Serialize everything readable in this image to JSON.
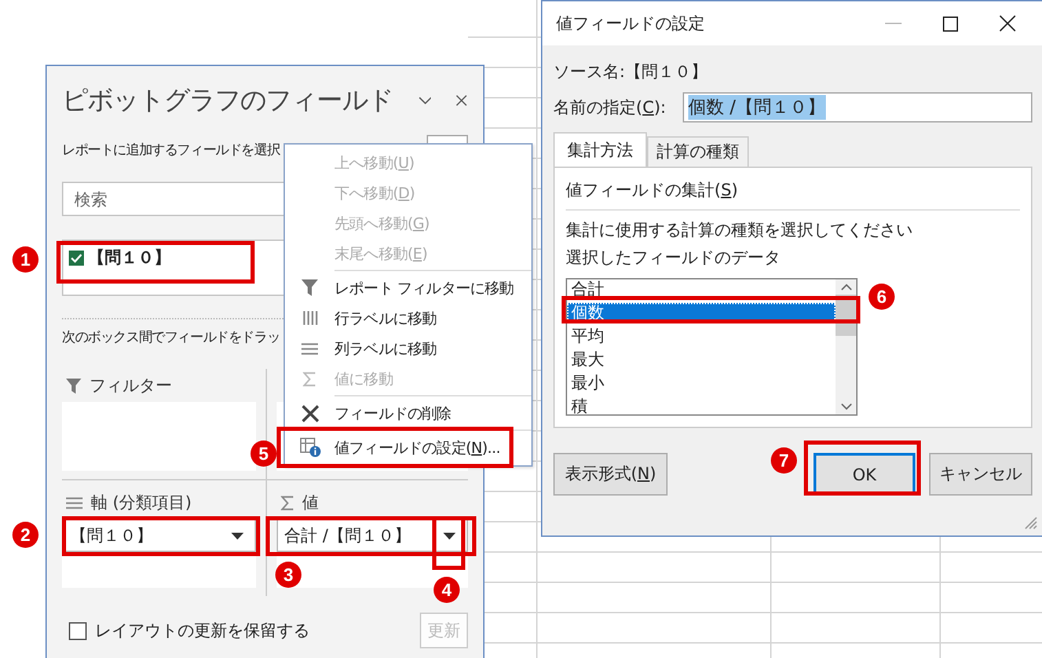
{
  "pivot_pane": {
    "title": "ピボットグラフのフィールド",
    "instruction": "レポートに追加するフィールドを選択",
    "search": {
      "placeholder": "検索"
    },
    "fields": [
      {
        "label": "【問１０】",
        "checked": true
      }
    ],
    "drag_hint": "次のボックス間でフィールドをドラッ",
    "areas": [
      {
        "kind": "filter",
        "label": "フィルター"
      },
      {
        "kind": "blank"
      },
      {
        "kind": "axis",
        "label": "軸 (分類項目)",
        "items": [
          "【問１０】"
        ]
      },
      {
        "kind": "values",
        "label": "値",
        "items": [
          "合計 /【問１０】"
        ]
      }
    ],
    "defer_update": {
      "label": "レイアウトの更新を保留する",
      "checked": false
    },
    "update_button": {
      "label": "更新",
      "disabled": true
    }
  },
  "context_menu": [
    {
      "label": "上へ移動(",
      "key": "U",
      "tail": ")",
      "disabled": true
    },
    {
      "label": "下へ移動(",
      "key": "D",
      "tail": ")",
      "disabled": true
    },
    {
      "label": "先頭へ移動(",
      "key": "G",
      "tail": ")",
      "disabled": true
    },
    {
      "label": "末尾へ移動(",
      "key": "E",
      "tail": ")",
      "disabled": true,
      "separator_after": true
    },
    {
      "label": "レポート フィルターに移動",
      "kind": "funnel",
      "disabled": false
    },
    {
      "label": "行ラベルに移動",
      "kind": "rows",
      "disabled": false
    },
    {
      "label": "列ラベルに移動",
      "kind": "columns",
      "disabled": false
    },
    {
      "label": "値に移動",
      "kind": "sigma",
      "disabled": true,
      "separator_after": true
    },
    {
      "label": "フィールドの削除",
      "kind": "delete",
      "disabled": false,
      "separator_after": true
    },
    {
      "label": "値フィールドの設定(",
      "key": "N",
      "tail": ")...",
      "kind": "settings",
      "disabled": false
    }
  ],
  "dialog": {
    "title": "値フィールドの設定",
    "source_label": "ソース名:",
    "source_value": "【問１０】",
    "name_label": "名前の指定(",
    "name_key": "C",
    "name_tail": "):",
    "name_value": "個数 /【問１０】",
    "name_selected": true,
    "tabs": [
      {
        "label": "集計方法",
        "selected": true
      },
      {
        "label": "計算の種類",
        "selected": false
      }
    ],
    "group_label": "値フィールドの集計(",
    "group_key": "S",
    "group_tail": ")",
    "prompt": "集計に使用する計算の種類を選択してください",
    "data_label": "選択したフィールドのデータ",
    "functions": [
      {
        "label": "合計",
        "selected": false
      },
      {
        "label": "個数",
        "selected": true
      },
      {
        "label": "平均",
        "selected": false
      },
      {
        "label": "最大",
        "selected": false
      },
      {
        "label": "最小",
        "selected": false
      },
      {
        "label": "積",
        "selected": false
      }
    ],
    "format_button": {
      "label": "表示形式(",
      "key": "N",
      "tail": ")"
    },
    "ok_button": {
      "label": "OK",
      "default": true
    },
    "cancel_button": {
      "label": "キャンセル"
    }
  },
  "annotations": [
    {
      "number": "1"
    },
    {
      "number": "2"
    },
    {
      "number": "3"
    },
    {
      "number": "4"
    },
    {
      "number": "5"
    },
    {
      "number": "6"
    },
    {
      "number": "7"
    }
  ]
}
